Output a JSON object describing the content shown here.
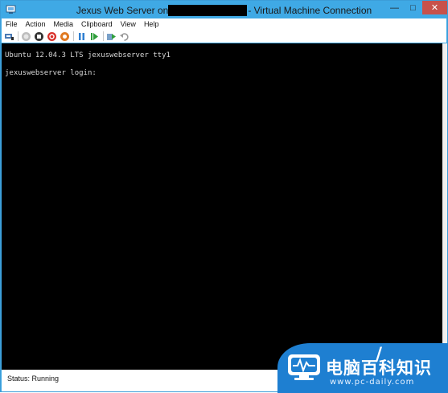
{
  "window": {
    "title_prefix": "Jexus Web Server on",
    "title_suffix": "- Virtual Machine Connection",
    "minimize_glyph": "—",
    "maximize_glyph": "□",
    "close_glyph": "✕"
  },
  "menu": {
    "items": [
      "File",
      "Action",
      "Media",
      "Clipboard",
      "View",
      "Help"
    ]
  },
  "toolbar": {
    "icons": [
      "ctrl-alt-del-icon",
      "start-icon",
      "turn-off-icon",
      "shut-down-icon",
      "save-icon",
      "pause-icon",
      "resume-icon",
      "checkpoint-icon",
      "revert-icon"
    ]
  },
  "console": {
    "line1": "Ubuntu 12.04.3 LTS jexuswebserver tty1",
    "line2": "jexuswebserver login:"
  },
  "status": {
    "text": "Status: Running"
  },
  "watermark": {
    "title": "电脑百科知识",
    "url": "www.pc-daily.com",
    "slash": "/"
  },
  "colors": {
    "titlebar": "#3fa9e5",
    "close_button": "#c7514b",
    "console_bg": "#000000",
    "watermark_blue": "#1e7fd1"
  }
}
